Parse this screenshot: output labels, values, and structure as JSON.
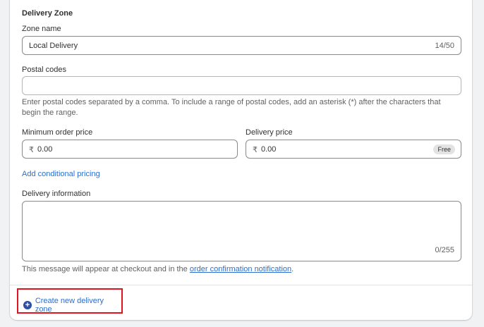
{
  "section_title": "Delivery Zone",
  "zone_name": {
    "label": "Zone name",
    "value": "Local Delivery",
    "counter": "14/50"
  },
  "postal_codes": {
    "label": "Postal codes",
    "value": "",
    "help": "Enter postal codes separated by a comma. To include a range of postal codes, add an asterisk (*) after the characters that begin the range."
  },
  "min_order_price": {
    "label": "Minimum order price",
    "currency": "₹",
    "value": "0.00"
  },
  "delivery_price": {
    "label": "Delivery price",
    "currency": "₹",
    "value": "0.00",
    "badge": "Free"
  },
  "add_conditional_pricing": "Add conditional pricing",
  "delivery_information": {
    "label": "Delivery information",
    "value": "",
    "counter": "0/255",
    "help_prefix": "This message will appear at checkout and in the ",
    "help_link": "order confirmation notification",
    "help_suffix": "."
  },
  "create_zone_button": "Create new delivery zone",
  "icons": {
    "create_zone": "plus-circle-icon"
  },
  "colors": {
    "link": "#2c6ecb",
    "highlight_border": "#e0141e"
  }
}
